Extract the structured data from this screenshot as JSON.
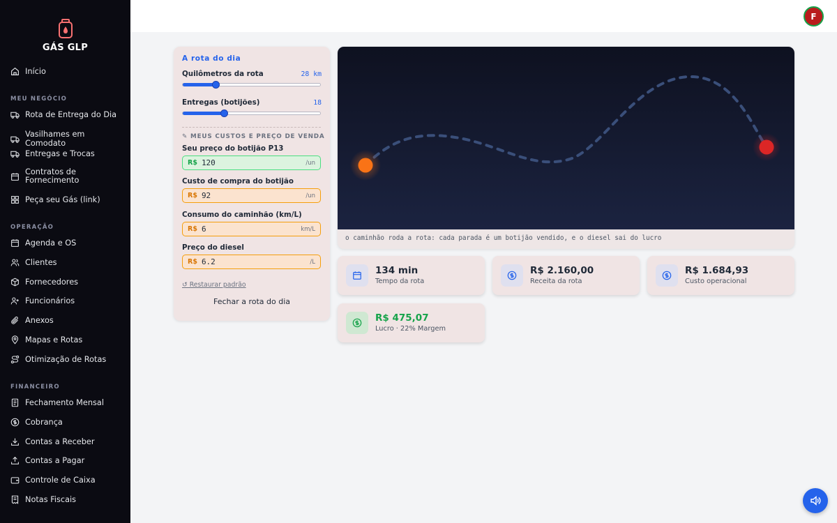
{
  "brand": {
    "name": "GÁS GLP",
    "icon": "gas-cylinder-icon"
  },
  "sidebar": {
    "home": "Início",
    "sections": [
      {
        "label": "MEU NEGÓCIO",
        "items": [
          "Rota de Entrega do Dia",
          "Vasilhames em Comodato",
          "Entregas e Trocas",
          "Contratos de Fornecimento",
          "Peça seu Gás (link)"
        ]
      },
      {
        "label": "OPERAÇÃO",
        "items": [
          "Agenda e OS",
          "Clientes",
          "Fornecedores",
          "Funcionários",
          "Anexos",
          "Mapas e Rotas",
          "Otimização de Rotas"
        ]
      },
      {
        "label": "FINANCEIRO",
        "items": [
          "Fechamento Mensal",
          "Cobrança",
          "Contas a Receber",
          "Contas a Pagar",
          "Controle de Caixa",
          "Notas Fiscais"
        ]
      }
    ]
  },
  "user": {
    "initial": "F"
  },
  "panel": {
    "title": "A rota do dia",
    "km": {
      "label": "Quilômetros da rota",
      "value": "28 km",
      "fraction": 0.24
    },
    "deliveries": {
      "label": "Entregas (botijões)",
      "value": "18",
      "fraction": 0.3
    },
    "costs_heading": "✎ MEUS CUSTOS E PREÇO DE VENDA",
    "fields": [
      {
        "label": "Seu preço do botijão P13",
        "currency": "R$",
        "value": "120",
        "unit": "/un",
        "tone": "green"
      },
      {
        "label": "Custo de compra do botijão",
        "currency": "R$",
        "value": "92",
        "unit": "/un",
        "tone": "orange"
      },
      {
        "label": "Consumo do caminhão (km/L)",
        "currency": "R$",
        "value": "6",
        "unit": "km/L",
        "tone": "orange"
      },
      {
        "label": "Preço do diesel",
        "currency": "R$",
        "value": "6.2",
        "unit": "/L",
        "tone": "orange"
      }
    ],
    "restore": "↺ Restaurar padrão",
    "close": "Fechar a rota do dia"
  },
  "viz": {
    "caption": "o caminhão roda a rota: cada parada é um botijão vendido, e o diesel sai do lucro",
    "colors": {
      "bg_top": "#0e1120",
      "bg_bottom": "#1b2340",
      "route": "#3a4f7a",
      "start": "#f97316",
      "end": "#dc2626"
    }
  },
  "stats": [
    {
      "value": "134 min",
      "label": "Tempo da rota",
      "icon": "calendar-icon",
      "tone": "blue"
    },
    {
      "value": "R$ 2.160,00",
      "label": "Receita da rota",
      "icon": "dollar-circle-icon",
      "tone": "blue"
    },
    {
      "value": "R$ 1.684,93",
      "label": "Custo operacional",
      "icon": "dollar-circle-icon",
      "tone": "blue"
    },
    {
      "value": "R$ 475,07",
      "label": "Lucro · 22% Margem",
      "icon": "dollar-circle-icon",
      "tone": "green"
    }
  ],
  "fab": {
    "icon": "speaker-icon"
  }
}
